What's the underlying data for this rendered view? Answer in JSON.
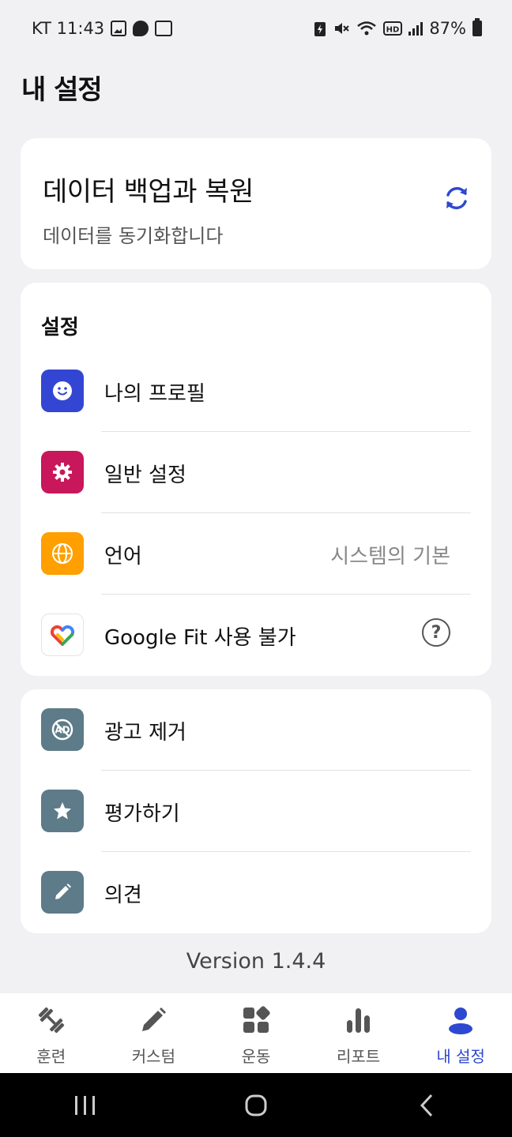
{
  "status_bar": {
    "carrier_time": "KT 11:43",
    "battery": "87%"
  },
  "page": {
    "title": "내 설정"
  },
  "backup": {
    "title": "데이터 백업과 복원",
    "subtitle": "데이터를 동기화합니다"
  },
  "settings": {
    "section_title": "설정",
    "items": [
      {
        "label": "나의 프로필",
        "icon": "smile-icon",
        "color": "#3346d3"
      },
      {
        "label": "일반 설정",
        "icon": "gear-icon",
        "color": "#c8175a"
      },
      {
        "label": "언어",
        "value": "시스템의 기본",
        "icon": "globe-icon",
        "color": "#ff9f00"
      },
      {
        "label": "Google Fit 사용 불가",
        "icon": "google-fit-icon",
        "color": "#ffffff"
      }
    ]
  },
  "extra": {
    "items": [
      {
        "label": "광고 제거",
        "icon": "no-ads-icon",
        "color": "#5d7b88"
      },
      {
        "label": "평가하기",
        "icon": "star-icon",
        "color": "#5d7b88"
      },
      {
        "label": "의견",
        "icon": "pencil-icon",
        "color": "#5d7b88"
      }
    ]
  },
  "version": "Version 1.4.4",
  "bottom_nav": {
    "items": [
      {
        "label": "훈련",
        "icon": "dumbbell-icon"
      },
      {
        "label": "커스텀",
        "icon": "pencil-icon"
      },
      {
        "label": "운동",
        "icon": "grid-icon"
      },
      {
        "label": "리포트",
        "icon": "bar-chart-icon"
      },
      {
        "label": "내 설정",
        "icon": "person-icon",
        "active": true
      }
    ],
    "active_color": "#2f48d0"
  }
}
